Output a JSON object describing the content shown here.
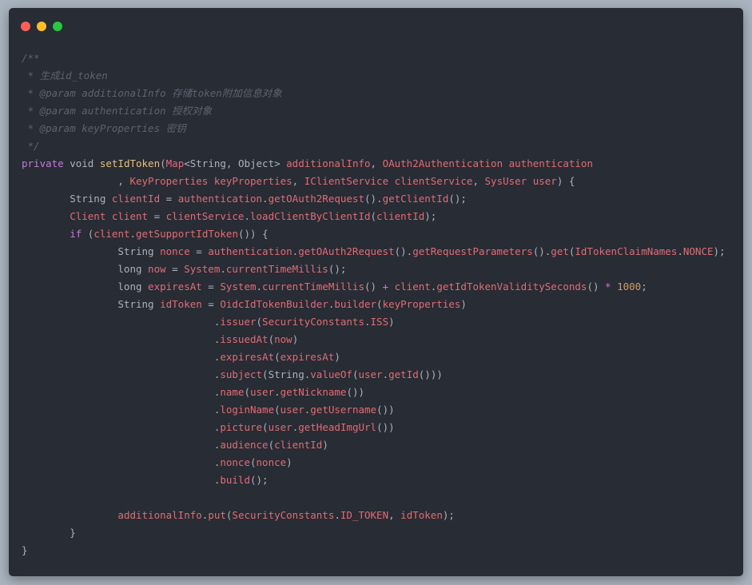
{
  "window": {
    "traffic_lights": [
      "close",
      "minimize",
      "maximize"
    ]
  },
  "colors": {
    "background": "#282c34",
    "comment": "#5c6370",
    "keyword": "#c678dd",
    "function": "#e5c07b",
    "variable": "#e06c75",
    "plain": "#abb2bf",
    "number": "#d19a66"
  },
  "code": {
    "lines": [
      [
        {
          "t": "c",
          "v": "/**"
        }
      ],
      [
        {
          "t": "c",
          "v": " * 生成id_token"
        }
      ],
      [
        {
          "t": "c",
          "v": " * @param additionalInfo 存储token附加信息对象"
        }
      ],
      [
        {
          "t": "c",
          "v": " * @param authentication 授权对象"
        }
      ],
      [
        {
          "t": "c",
          "v": " * @param keyProperties 密钥"
        }
      ],
      [
        {
          "t": "c",
          "v": " */"
        }
      ],
      [
        {
          "t": "k",
          "v": "private"
        },
        {
          "t": "p",
          "v": " void "
        },
        {
          "t": "f",
          "v": "setIdToken"
        },
        {
          "t": "p",
          "v": "("
        },
        {
          "t": "v",
          "v": "Map"
        },
        {
          "t": "p",
          "v": "<String, Object> "
        },
        {
          "t": "v",
          "v": "additionalInfo"
        },
        {
          "t": "p",
          "v": ", "
        },
        {
          "t": "v",
          "v": "OAuth2Authentication authentication"
        }
      ],
      [
        {
          "t": "p",
          "v": "                , "
        },
        {
          "t": "v",
          "v": "KeyProperties keyProperties"
        },
        {
          "t": "p",
          "v": ", "
        },
        {
          "t": "v",
          "v": "IClientService clientService"
        },
        {
          "t": "p",
          "v": ", "
        },
        {
          "t": "v",
          "v": "SysUser user"
        },
        {
          "t": "p",
          "v": ") {"
        }
      ],
      [
        {
          "t": "p",
          "v": "        String "
        },
        {
          "t": "v",
          "v": "clientId"
        },
        {
          "t": "p",
          "v": " = "
        },
        {
          "t": "v",
          "v": "authentication"
        },
        {
          "t": "p",
          "v": "."
        },
        {
          "t": "v",
          "v": "getOAuth2Request"
        },
        {
          "t": "p",
          "v": "()."
        },
        {
          "t": "v",
          "v": "getClientId"
        },
        {
          "t": "p",
          "v": "();"
        }
      ],
      [
        {
          "t": "v",
          "v": "        Client client"
        },
        {
          "t": "p",
          "v": " = "
        },
        {
          "t": "v",
          "v": "clientService"
        },
        {
          "t": "p",
          "v": "."
        },
        {
          "t": "v",
          "v": "loadClientByClientId"
        },
        {
          "t": "p",
          "v": "("
        },
        {
          "t": "v",
          "v": "clientId"
        },
        {
          "t": "p",
          "v": ");"
        }
      ],
      [
        {
          "t": "p",
          "v": "        "
        },
        {
          "t": "k",
          "v": "if"
        },
        {
          "t": "p",
          "v": " ("
        },
        {
          "t": "v",
          "v": "client"
        },
        {
          "t": "p",
          "v": "."
        },
        {
          "t": "v",
          "v": "getSupportIdToken"
        },
        {
          "t": "p",
          "v": "()) {"
        }
      ],
      [
        {
          "t": "p",
          "v": "                String "
        },
        {
          "t": "v",
          "v": "nonce"
        },
        {
          "t": "p",
          "v": " = "
        },
        {
          "t": "v",
          "v": "authentication"
        },
        {
          "t": "p",
          "v": "."
        },
        {
          "t": "v",
          "v": "getOAuth2Request"
        },
        {
          "t": "p",
          "v": "()."
        },
        {
          "t": "v",
          "v": "getRequestParameters"
        },
        {
          "t": "p",
          "v": "()."
        },
        {
          "t": "v",
          "v": "get"
        },
        {
          "t": "p",
          "v": "("
        },
        {
          "t": "v",
          "v": "IdTokenClaimNames"
        },
        {
          "t": "p",
          "v": "."
        },
        {
          "t": "v",
          "v": "NONCE"
        },
        {
          "t": "p",
          "v": ");"
        }
      ],
      [
        {
          "t": "p",
          "v": "                long "
        },
        {
          "t": "v",
          "v": "now"
        },
        {
          "t": "p",
          "v": " = "
        },
        {
          "t": "v",
          "v": "System"
        },
        {
          "t": "p",
          "v": "."
        },
        {
          "t": "v",
          "v": "currentTimeMillis"
        },
        {
          "t": "p",
          "v": "();"
        }
      ],
      [
        {
          "t": "p",
          "v": "                long "
        },
        {
          "t": "v",
          "v": "expiresAt"
        },
        {
          "t": "p",
          "v": " = "
        },
        {
          "t": "v",
          "v": "System"
        },
        {
          "t": "p",
          "v": "."
        },
        {
          "t": "v",
          "v": "currentTimeMillis"
        },
        {
          "t": "p",
          "v": "() "
        },
        {
          "t": "k",
          "v": "+"
        },
        {
          "t": "p",
          "v": " "
        },
        {
          "t": "v",
          "v": "client"
        },
        {
          "t": "p",
          "v": "."
        },
        {
          "t": "v",
          "v": "getIdTokenValiditySeconds"
        },
        {
          "t": "p",
          "v": "() "
        },
        {
          "t": "k",
          "v": "*"
        },
        {
          "t": "p",
          "v": " "
        },
        {
          "t": "n",
          "v": "1000"
        },
        {
          "t": "p",
          "v": ";"
        }
      ],
      [
        {
          "t": "p",
          "v": "                String "
        },
        {
          "t": "v",
          "v": "idToken"
        },
        {
          "t": "p",
          "v": " = "
        },
        {
          "t": "v",
          "v": "OidcIdTokenBuilder"
        },
        {
          "t": "p",
          "v": "."
        },
        {
          "t": "v",
          "v": "builder"
        },
        {
          "t": "p",
          "v": "("
        },
        {
          "t": "v",
          "v": "keyProperties"
        },
        {
          "t": "p",
          "v": ")"
        }
      ],
      [
        {
          "t": "p",
          "v": "                                ."
        },
        {
          "t": "v",
          "v": "issuer"
        },
        {
          "t": "p",
          "v": "("
        },
        {
          "t": "v",
          "v": "SecurityConstants"
        },
        {
          "t": "p",
          "v": "."
        },
        {
          "t": "v",
          "v": "ISS"
        },
        {
          "t": "p",
          "v": ")"
        }
      ],
      [
        {
          "t": "p",
          "v": "                                ."
        },
        {
          "t": "v",
          "v": "issuedAt"
        },
        {
          "t": "p",
          "v": "("
        },
        {
          "t": "v",
          "v": "now"
        },
        {
          "t": "p",
          "v": ")"
        }
      ],
      [
        {
          "t": "p",
          "v": "                                ."
        },
        {
          "t": "v",
          "v": "expiresAt"
        },
        {
          "t": "p",
          "v": "("
        },
        {
          "t": "v",
          "v": "expiresAt"
        },
        {
          "t": "p",
          "v": ")"
        }
      ],
      [
        {
          "t": "p",
          "v": "                                ."
        },
        {
          "t": "v",
          "v": "subject"
        },
        {
          "t": "p",
          "v": "(String."
        },
        {
          "t": "v",
          "v": "valueOf"
        },
        {
          "t": "p",
          "v": "("
        },
        {
          "t": "v",
          "v": "user"
        },
        {
          "t": "p",
          "v": "."
        },
        {
          "t": "v",
          "v": "getId"
        },
        {
          "t": "p",
          "v": "()))"
        }
      ],
      [
        {
          "t": "p",
          "v": "                                ."
        },
        {
          "t": "v",
          "v": "name"
        },
        {
          "t": "p",
          "v": "("
        },
        {
          "t": "v",
          "v": "user"
        },
        {
          "t": "p",
          "v": "."
        },
        {
          "t": "v",
          "v": "getNickname"
        },
        {
          "t": "p",
          "v": "())"
        }
      ],
      [
        {
          "t": "p",
          "v": "                                ."
        },
        {
          "t": "v",
          "v": "loginName"
        },
        {
          "t": "p",
          "v": "("
        },
        {
          "t": "v",
          "v": "user"
        },
        {
          "t": "p",
          "v": "."
        },
        {
          "t": "v",
          "v": "getUsername"
        },
        {
          "t": "p",
          "v": "())"
        }
      ],
      [
        {
          "t": "p",
          "v": "                                ."
        },
        {
          "t": "v",
          "v": "picture"
        },
        {
          "t": "p",
          "v": "("
        },
        {
          "t": "v",
          "v": "user"
        },
        {
          "t": "p",
          "v": "."
        },
        {
          "t": "v",
          "v": "getHeadImgUrl"
        },
        {
          "t": "p",
          "v": "())"
        }
      ],
      [
        {
          "t": "p",
          "v": "                                ."
        },
        {
          "t": "v",
          "v": "audience"
        },
        {
          "t": "p",
          "v": "("
        },
        {
          "t": "v",
          "v": "clientId"
        },
        {
          "t": "p",
          "v": ")"
        }
      ],
      [
        {
          "t": "p",
          "v": "                                ."
        },
        {
          "t": "v",
          "v": "nonce"
        },
        {
          "t": "p",
          "v": "("
        },
        {
          "t": "v",
          "v": "nonce"
        },
        {
          "t": "p",
          "v": ")"
        }
      ],
      [
        {
          "t": "p",
          "v": "                                ."
        },
        {
          "t": "v",
          "v": "build"
        },
        {
          "t": "p",
          "v": "();"
        }
      ],
      [
        {
          "t": "p",
          "v": ""
        }
      ],
      [
        {
          "t": "p",
          "v": "                "
        },
        {
          "t": "v",
          "v": "additionalInfo"
        },
        {
          "t": "p",
          "v": "."
        },
        {
          "t": "v",
          "v": "put"
        },
        {
          "t": "p",
          "v": "("
        },
        {
          "t": "v",
          "v": "SecurityConstants"
        },
        {
          "t": "p",
          "v": "."
        },
        {
          "t": "v",
          "v": "ID_TOKEN"
        },
        {
          "t": "p",
          "v": ", "
        },
        {
          "t": "v",
          "v": "idToken"
        },
        {
          "t": "p",
          "v": ");"
        }
      ],
      [
        {
          "t": "p",
          "v": "        }"
        }
      ],
      [
        {
          "t": "p",
          "v": "}"
        }
      ]
    ]
  }
}
